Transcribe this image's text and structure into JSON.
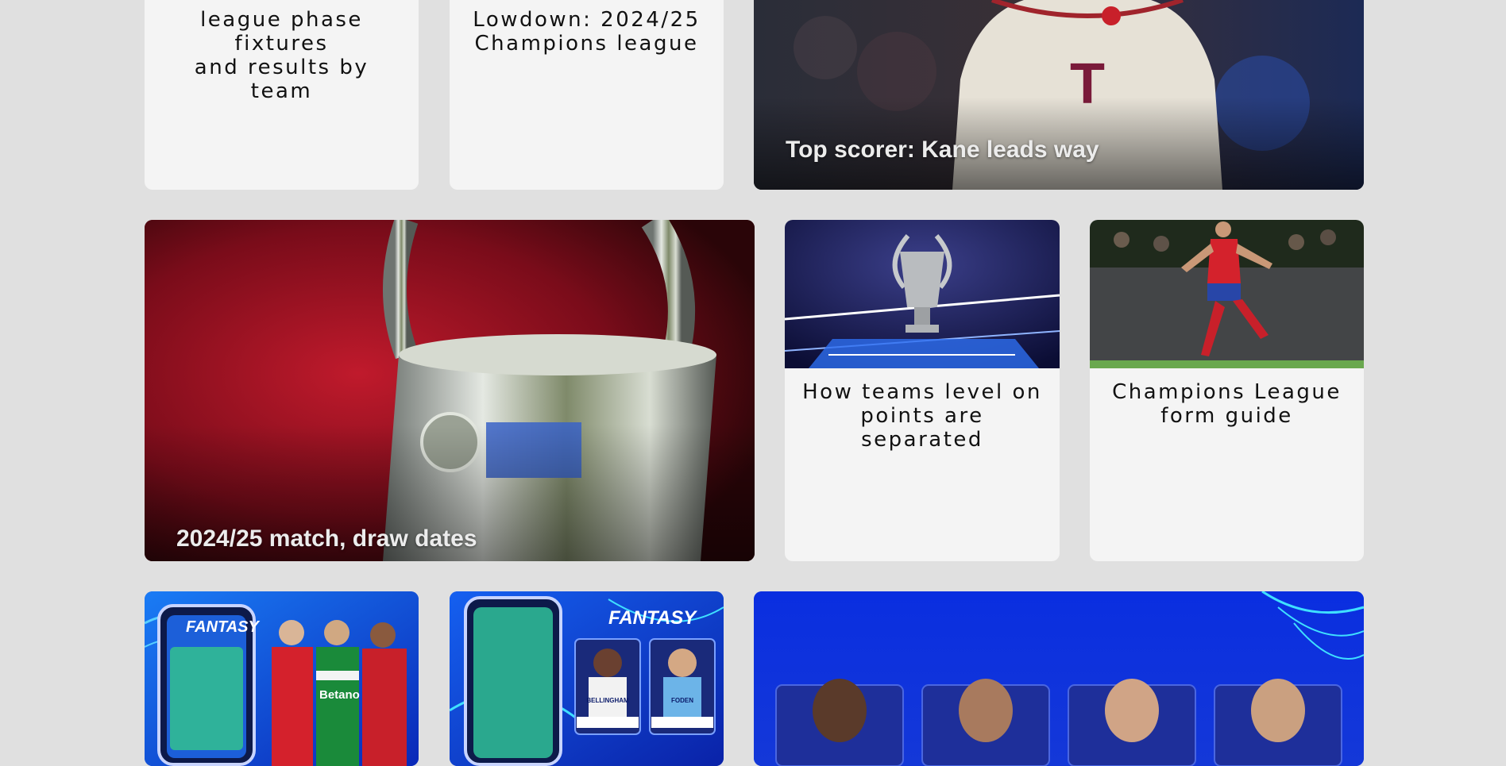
{
  "row1": {
    "card1": {
      "title_line1": "league phase fixtures",
      "title_line2": "and results by team"
    },
    "card2": {
      "title_line1": "Lowdown: 2024/25",
      "title_line2": "Champions league"
    },
    "card3": {
      "title": "Top scorer: Kane leads way"
    }
  },
  "row2": {
    "feature": {
      "title": "2024/25 match, draw dates"
    },
    "card1": {
      "title_line1": "How teams level on",
      "title_line2": "points are separated"
    },
    "card2": {
      "title_line1": "Champions League",
      "title_line2": "form guide"
    }
  },
  "row3": {
    "card1": {
      "brand": "FANTASY",
      "sponsor": "Betano"
    },
    "card2": {
      "brand": "FANTASY",
      "player1": "BELLINGHAM",
      "player2": "FODEN"
    }
  },
  "colors": {
    "page_bg": "#e0e0e0",
    "card_bg": "#f4f4f4",
    "fantasy_blue": "#0a3de0",
    "trophy_red": "#8a1020"
  }
}
